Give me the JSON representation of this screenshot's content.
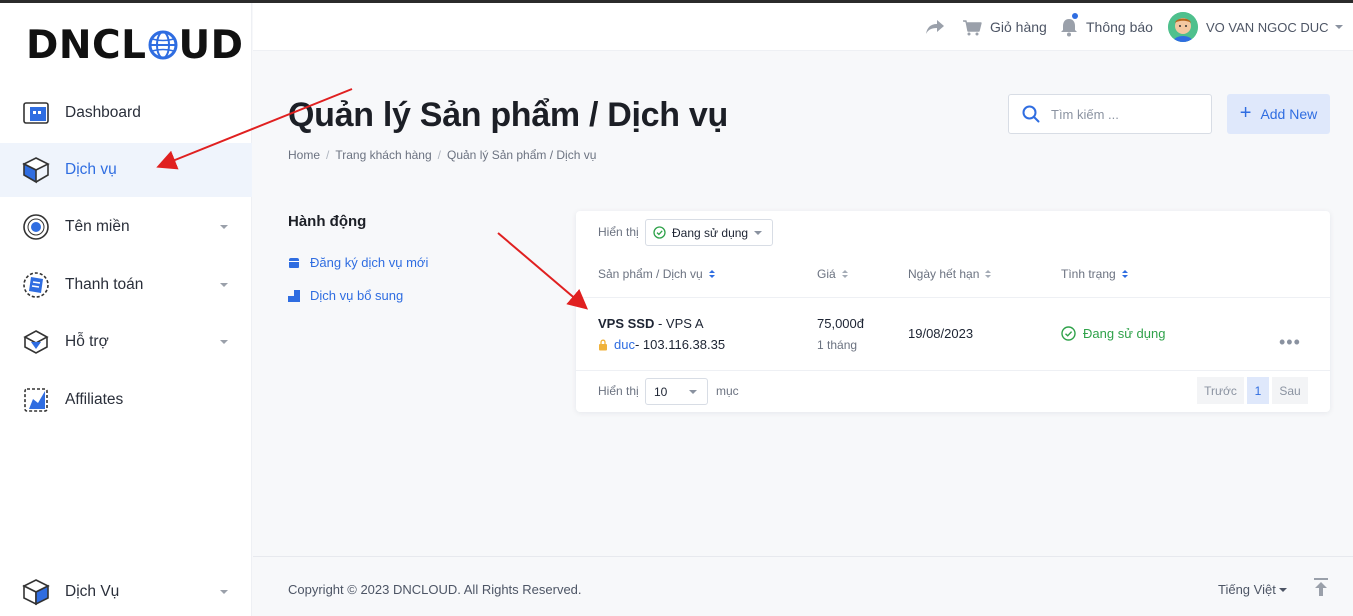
{
  "brand": {
    "logo_left": "DNCL",
    "logo_right": "UD"
  },
  "sidebar": {
    "items": [
      {
        "label": "Dashboard"
      },
      {
        "label": "Dịch vụ"
      },
      {
        "label": "Tên miền"
      },
      {
        "label": "Thanh toán"
      },
      {
        "label": "Hỗ trợ"
      },
      {
        "label": "Affiliates"
      }
    ],
    "bottom_item": {
      "label": "Dịch Vụ"
    }
  },
  "header": {
    "cart_label": "Giỏ hàng",
    "notifications_label": "Thông báo",
    "user_name": "VO VAN NGOC DUC"
  },
  "page": {
    "title": "Quản lý Sản phẩm / Dịch vụ",
    "breadcrumb": [
      "Home",
      "Trang khách hàng",
      "Quản lý Sản phẩm / Dịch vụ"
    ],
    "search_placeholder": "Tìm kiếm ...",
    "add_new_label": "Add New"
  },
  "actions": {
    "title": "Hành động",
    "links": [
      "Đăng ký dịch vụ mới",
      "Dịch vụ bổ sung"
    ]
  },
  "table": {
    "filter_label": "Hiển thị",
    "filter_value": "Đang sử dụng",
    "columns": [
      "Sản phẩm / Dịch vụ",
      "Giá",
      "Ngày hết hạn",
      "Tình trạng"
    ],
    "rows": [
      {
        "product_bold": "VPS SSD",
        "product_rest": " - VPS A",
        "username": "duc",
        "ip": " - 103.116.38.35",
        "price": "75,000đ",
        "cycle": "1 tháng",
        "expiry": "19/08/2023",
        "status": "Đang sử dụng"
      }
    ],
    "page_size_label": "Hiển thị",
    "page_size_value": "10",
    "page_size_suffix": "mục",
    "pagination": {
      "prev": "Trước",
      "current": "1",
      "next": "Sau"
    }
  },
  "footer": {
    "copyright": "Copyright © 2023 DNCLOUD. All Rights Reserved.",
    "language": "Tiếng Việt"
  },
  "colors": {
    "accent": "#2f6de1",
    "success": "#2fa24a",
    "annotation": "#e02020"
  }
}
